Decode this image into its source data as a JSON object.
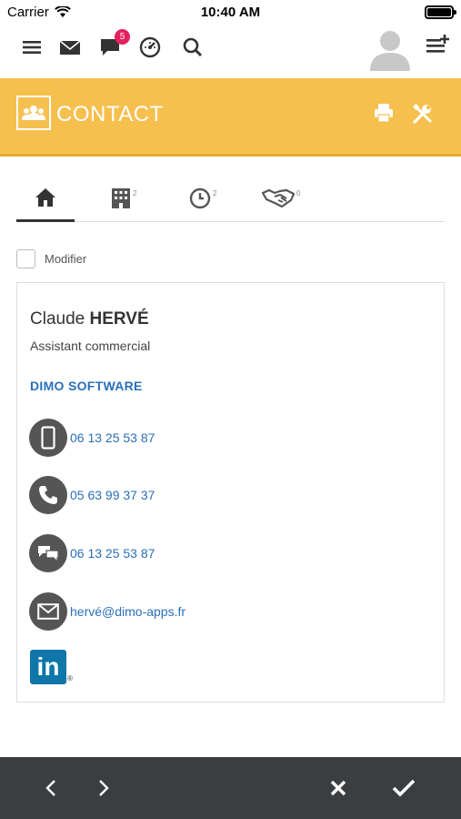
{
  "status_bar": {
    "carrier": "Carrier",
    "time": "10:40 AM"
  },
  "toolbar": {
    "icons": [
      "menu-icon",
      "mail-icon",
      "chat-icon",
      "dashboard-icon",
      "search-icon",
      "user-avatar-icon",
      "add-list-icon"
    ],
    "notification_count": "5"
  },
  "header": {
    "title": "CONTACT",
    "color": "#f6c04e"
  },
  "tabs": {
    "home": {
      "icon": "home-icon"
    },
    "company": {
      "icon": "building-icon",
      "count": "2"
    },
    "activity": {
      "icon": "clock-icon",
      "count": "2"
    },
    "deals": {
      "icon": "handshake-icon",
      "count": "0"
    }
  },
  "modifier": {
    "label": "Modifier",
    "checked": false
  },
  "contact": {
    "first_name": "Claude",
    "last_name": "HERVÉ",
    "job_title": "Assistant commercial",
    "company": "DIMO SOFTWARE",
    "mobile": "06 13 25 53 87",
    "phone": "05 63 99 37 37",
    "sms": "06 13 25 53 87",
    "email": "hervé@dimo-apps.fr",
    "linkedin": {
      "text": "in",
      "reg": "®"
    }
  },
  "colors": {
    "accent": "#f6c04e",
    "link": "#2a6fb8",
    "bottom_bar": "#3a3e41",
    "badge": "#e5205f"
  }
}
